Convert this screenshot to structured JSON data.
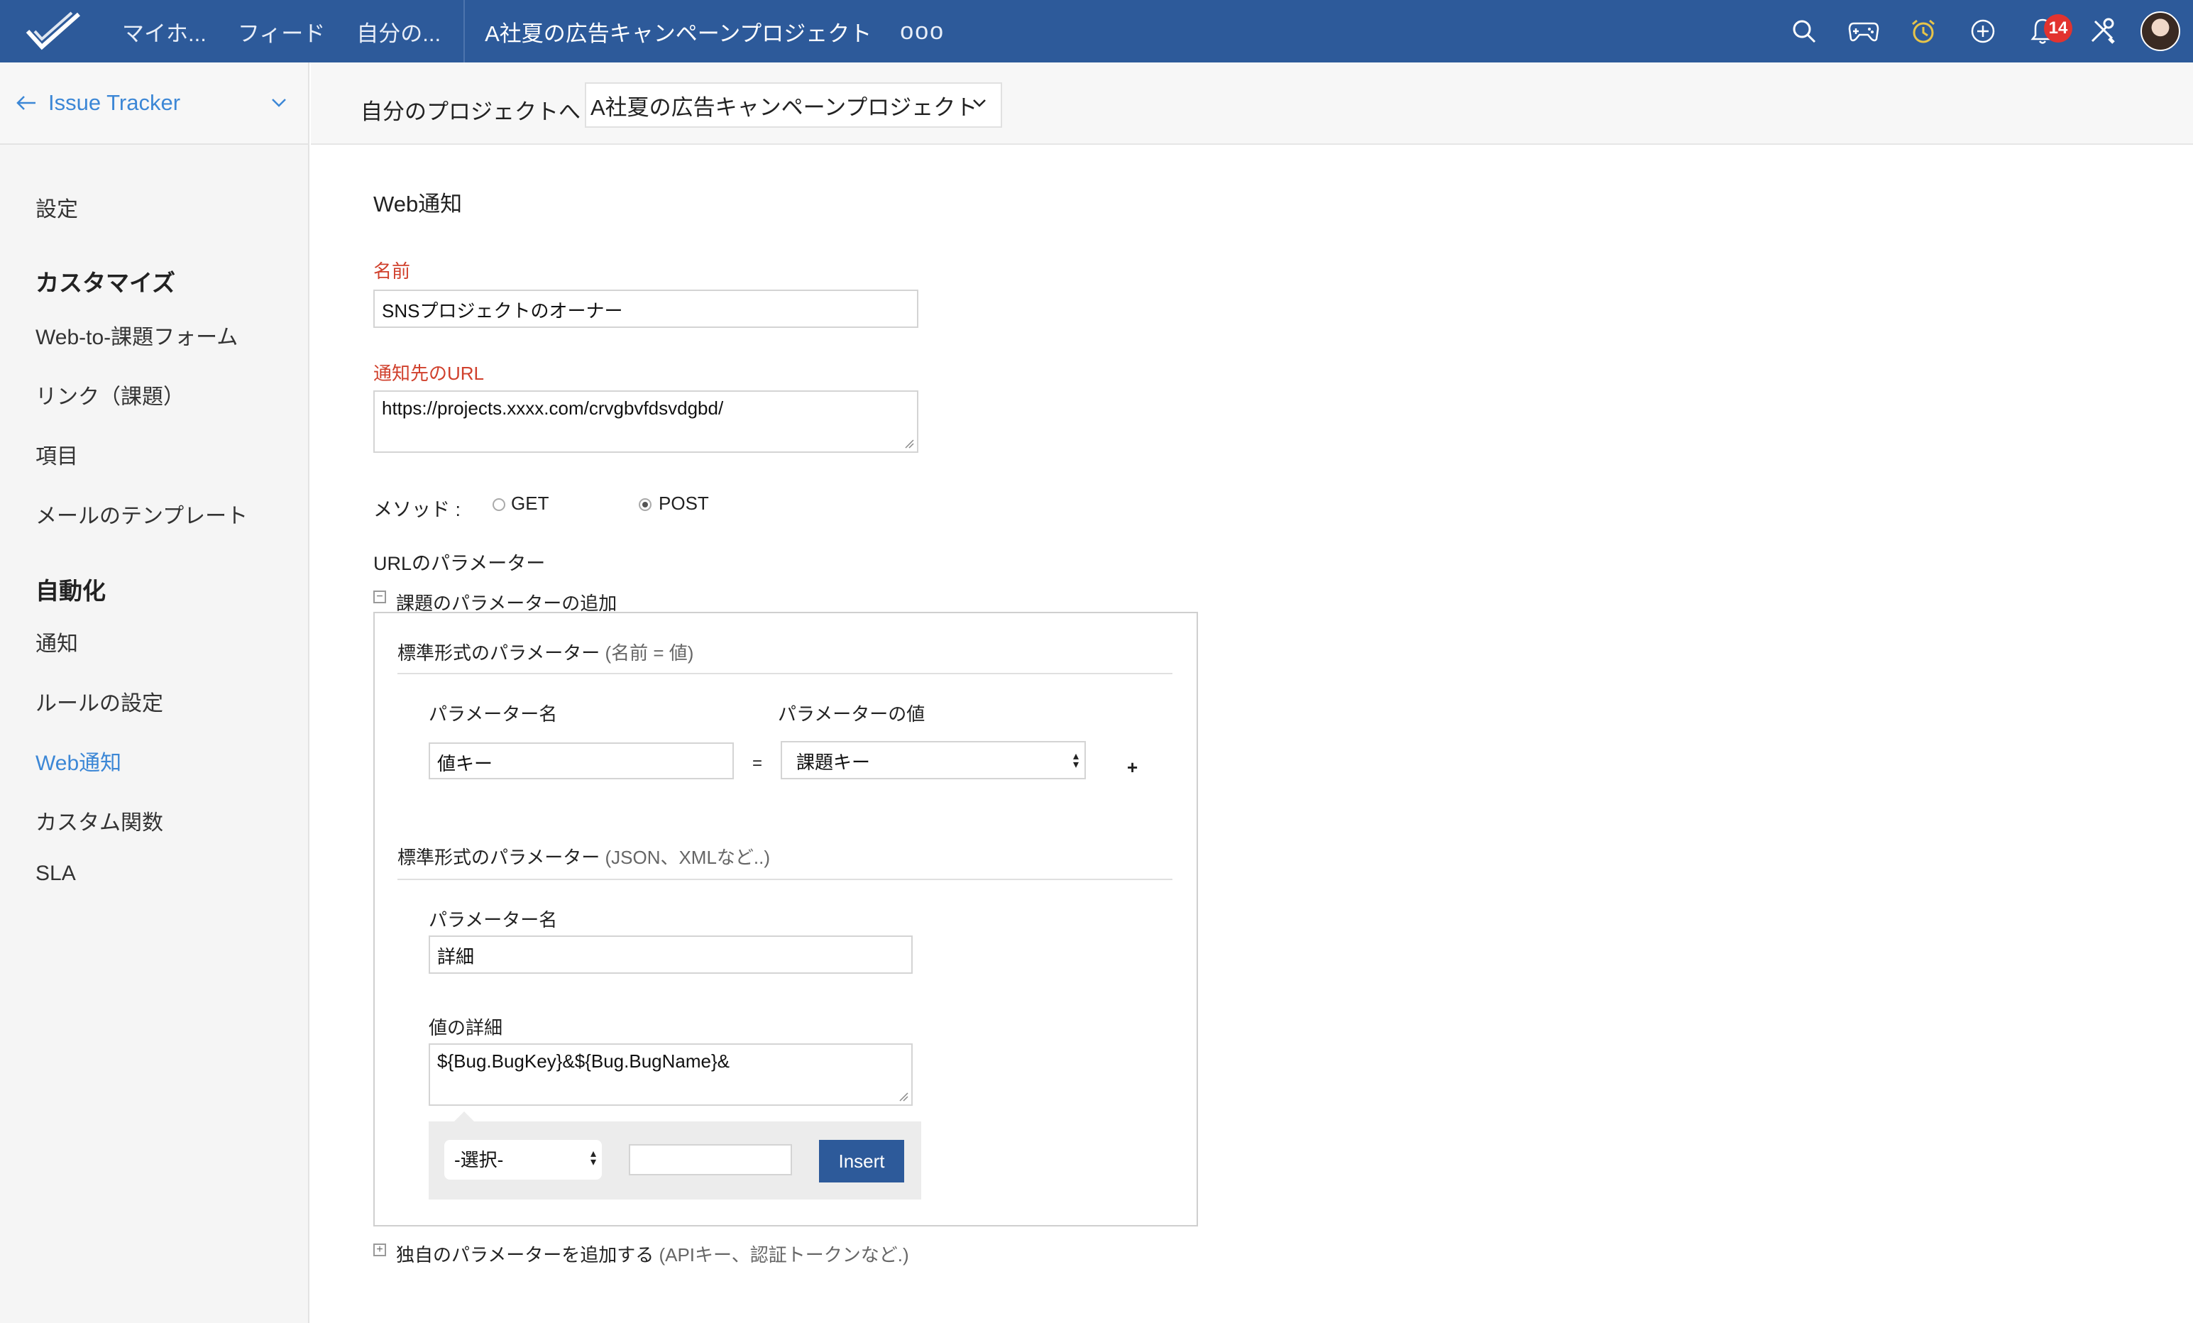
{
  "topbar": {
    "nav": [
      "マイホ...",
      "フィード",
      "自分の..."
    ],
    "active_project": "A社夏の広告キャンペーンプロジェクト",
    "more": "ooo",
    "badge_count": "14",
    "brand_color": "#2d5a9a"
  },
  "sidebar": {
    "title": "Issue Tracker",
    "settings": "設定",
    "customize_heading": "カスタマイズ",
    "customize_items": [
      "Web-to-課題フォーム",
      "リンク（課題）",
      "項目",
      "メールのテンプレート"
    ],
    "automation_heading": "自動化",
    "automation_items": [
      "通知",
      "ルールの設定",
      "Web通知",
      "カスタム関数",
      "SLA"
    ]
  },
  "subheader": {
    "label": "自分のプロジェクトへ",
    "project": "A社夏の広告キャンペーンプロジェクト"
  },
  "form": {
    "title": "Web通知",
    "name_label": "名前",
    "name_value": "SNSプロジェクトのオーナー",
    "url_label": "通知先のURL",
    "url_value": "https://projects.xxxx.com/crvgbvfdsvdgbd/",
    "method_label": "メソッド :",
    "method_get": "GET",
    "method_post": "POST",
    "url_params_label": "URLのパラメーター",
    "add_issue_params": "課題のパラメーターの追加",
    "standard_params": "標準形式のパラメーター",
    "standard_params_hint": "(名前 = 値)",
    "param_name_header": "パラメーター名",
    "param_value_header": "パラメーターの値",
    "param_name_value": "値キー",
    "equals": "=",
    "param_value_select": "課題キー",
    "plus": "+",
    "standard_params2_hint": "(JSON、XMLなど..)",
    "param_name2_label": "パラメーター名",
    "param_name2_value": "詳細",
    "value_detail_label": "値の詳細",
    "value_detail": "${Bug.BugKey}&${Bug.BugName}&",
    "insert_select": "-選択-",
    "insert_button": "Insert",
    "custom_params": "独自のパラメーターを追加する",
    "custom_params_hint": "(APIキー、認証トークンなど.)"
  }
}
